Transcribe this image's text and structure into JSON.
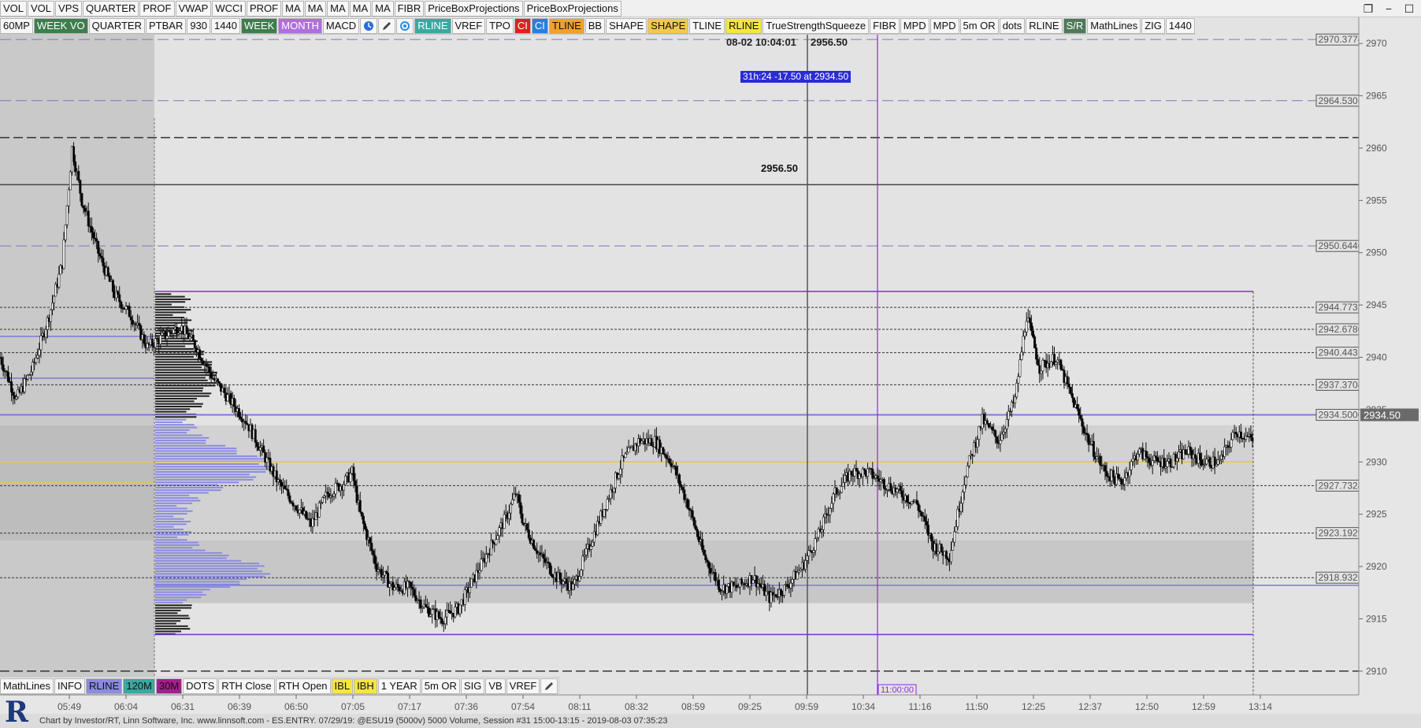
{
  "toolbar_top": [
    "VOL",
    "VOL",
    "VPS",
    "QUARTER",
    "PROF",
    "VWAP",
    "WCCI",
    "PROF",
    "MA",
    "MA",
    "MA",
    "MA",
    "MA",
    "FIBR",
    "PriceBoxProjections",
    "PriceBoxProjections"
  ],
  "toolbar_second": [
    {
      "label": "60MP",
      "bg": "#f7f7f7",
      "fg": "#111"
    },
    {
      "label": "WEEK VO",
      "bg": "#3e7d4e",
      "fg": "#ffffff"
    },
    {
      "label": "QUARTER",
      "bg": "#f7f7f7",
      "fg": "#111"
    },
    {
      "label": "PTBAR",
      "bg": "#f7f7f7",
      "fg": "#111"
    },
    {
      "label": "930",
      "bg": "#f7f7f7",
      "fg": "#111"
    },
    {
      "label": "1440",
      "bg": "#f7f7f7",
      "fg": "#111"
    },
    {
      "label": "WEEK",
      "bg": "#3e7d4e",
      "fg": "#ffffff"
    },
    {
      "label": "MONTH",
      "bg": "#b06ee0",
      "fg": "#ffffff"
    },
    {
      "label": "MACD",
      "bg": "#f7f7f7",
      "fg": "#111"
    },
    {
      "icon": "clock-icon"
    },
    {
      "icon": "pencil-icon"
    },
    {
      "icon": "refresh-icon"
    },
    {
      "label": "RLINE",
      "bg": "#3aa9a0",
      "fg": "#ffffff"
    },
    {
      "label": "VREF",
      "bg": "#f7f7f7",
      "fg": "#111"
    },
    {
      "label": "TPO",
      "bg": "#f7f7f7",
      "fg": "#111"
    },
    {
      "label": "CI",
      "bg": "#e02020",
      "fg": "#ffffff"
    },
    {
      "label": "CI",
      "bg": "#2a7ee0",
      "fg": "#ffffff"
    },
    {
      "label": "TLINE",
      "bg": "#f2a02a",
      "fg": "#111"
    },
    {
      "label": "BB",
      "bg": "#f7f7f7",
      "fg": "#111"
    },
    {
      "label": "SHAPE",
      "bg": "#f7f7f7",
      "fg": "#111"
    },
    {
      "label": "SHAPE",
      "bg": "#f2c94c",
      "fg": "#111"
    },
    {
      "label": "TLINE",
      "bg": "#f7f7f7",
      "fg": "#111"
    },
    {
      "label": "RLINE",
      "bg": "#f5e642",
      "fg": "#111"
    },
    {
      "label": "TrueStrengthSqueeze",
      "bg": "#f7f7f7",
      "fg": "#111"
    },
    {
      "label": "FIBR",
      "bg": "#f7f7f7",
      "fg": "#111"
    },
    {
      "label": "MPD",
      "bg": "#f7f7f7",
      "fg": "#111"
    },
    {
      "label": "MPD",
      "bg": "#f7f7f7",
      "fg": "#111"
    },
    {
      "label": "5m OR",
      "bg": "#f7f7f7",
      "fg": "#111"
    },
    {
      "label": "dots",
      "bg": "#f7f7f7",
      "fg": "#111"
    },
    {
      "label": "RLINE",
      "bg": "#f7f7f7",
      "fg": "#111"
    },
    {
      "label": "S/R",
      "bg": "#4f7a58",
      "fg": "#ffffff"
    },
    {
      "label": "MathLines",
      "bg": "#f7f7f7",
      "fg": "#111"
    },
    {
      "label": "ZIG",
      "bg": "#f7f7f7",
      "fg": "#111"
    },
    {
      "label": "1440",
      "bg": "#f7f7f7",
      "fg": "#111"
    }
  ],
  "toolbar_bottom": [
    {
      "label": "MathLines",
      "bg": "#f7f7f7",
      "fg": "#111"
    },
    {
      "label": "INFO",
      "bg": "#f7f7f7",
      "fg": "#111"
    },
    {
      "label": "RLINE",
      "bg": "#8b8be0",
      "fg": "#111"
    },
    {
      "label": "120M",
      "bg": "#3aa9a0",
      "fg": "#111"
    },
    {
      "label": "30M",
      "bg": "#a0208f",
      "fg": "#111"
    },
    {
      "label": "DOTS",
      "bg": "#f7f7f7",
      "fg": "#111"
    },
    {
      "label": "RTH Close",
      "bg": "#f7f7f7",
      "fg": "#111"
    },
    {
      "label": "RTH Open",
      "bg": "#f7f7f7",
      "fg": "#111"
    },
    {
      "label": "IBL",
      "bg": "#f5e642",
      "fg": "#111"
    },
    {
      "label": "IBH",
      "bg": "#f5e642",
      "fg": "#111"
    },
    {
      "label": "1 YEAR",
      "bg": "#f7f7f7",
      "fg": "#111"
    },
    {
      "label": "5m OR",
      "bg": "#f7f7f7",
      "fg": "#111"
    },
    {
      "label": "SIG",
      "bg": "#f7f7f7",
      "fg": "#111"
    },
    {
      "label": "VB",
      "bg": "#f7f7f7",
      "fg": "#111"
    },
    {
      "label": "VREF",
      "bg": "#f7f7f7",
      "fg": "#111"
    },
    {
      "icon": "pencil-icon"
    }
  ],
  "info": {
    "time": "08-02 10:04:01",
    "price": "2956.50",
    "measure": "31h:24  -17.50 at 2934.50",
    "hline_label": "2956.50",
    "time_marker": "11:00:00"
  },
  "footer": {
    "text": "Chart by Investor/RT, Linn Software, Inc. www.linnsoft.com - ES.ENTRY.  07/29/19: @ESU19 (5000v) 5000 Volume, Session #31 15:00-13:15 - 2019-08-03 07:35:23"
  },
  "chart_data": {
    "type": "candlestick",
    "symbol": "@ESU19",
    "ylim": [
      2907.5,
      2972.5
    ],
    "y_ticks": [
      2910,
      2915,
      2920,
      2925,
      2930,
      2935,
      2940,
      2945,
      2950,
      2955,
      2960,
      2965,
      2970
    ],
    "x_tick_labels": [
      "05:49",
      "06:04",
      "06:31",
      "06:39",
      "06:50",
      "07:05",
      "07:17",
      "07:36",
      "07:54",
      "08:11",
      "08:32",
      "08:59",
      "09:25",
      "09:59",
      "10:34",
      "11:16",
      "11:50",
      "12:25",
      "12:37",
      "12:50",
      "12:59",
      "13:14"
    ],
    "last_price": "2934.50",
    "price_levels": [
      {
        "value": 2970.3774,
        "label": "2970.3774",
        "style": "dashed"
      },
      {
        "value": 2964.5305,
        "label": "2964.5305",
        "style": "dashed"
      },
      {
        "value": 2950.644,
        "label": "2950.6440",
        "style": "dashed"
      },
      {
        "value": 2944.7732,
        "label": "2944.7732",
        "style": "dotted"
      },
      {
        "value": 2942.678,
        "label": "2942.6780",
        "style": "dotted"
      },
      {
        "value": 2940.4431,
        "label": "2940.4431",
        "style": "dotted"
      },
      {
        "value": 2937.3704,
        "label": "2937.3704",
        "style": "dotted"
      },
      {
        "value": 2934.5,
        "label": "2934.5000",
        "style": "solid"
      },
      {
        "value": 2927.7324,
        "label": "2927.7324",
        "style": "dotted"
      },
      {
        "value": 2923.1929,
        "label": "2923.1929",
        "style": "dotted"
      },
      {
        "value": 2918.9326,
        "label": "2918.9326",
        "style": "dotted"
      }
    ],
    "path_keypoints": [
      [
        0,
        2940
      ],
      [
        10,
        2936
      ],
      [
        20,
        2939
      ],
      [
        30,
        2944
      ],
      [
        38,
        2949
      ],
      [
        44,
        2960
      ],
      [
        50,
        2955
      ],
      [
        60,
        2950
      ],
      [
        70,
        2946
      ],
      [
        80,
        2944
      ],
      [
        90,
        2941
      ],
      [
        100,
        2942
      ],
      [
        110,
        2943
      ],
      [
        120,
        2941
      ],
      [
        130,
        2938
      ],
      [
        140,
        2936
      ],
      [
        150,
        2934
      ],
      [
        160,
        2931
      ],
      [
        170,
        2928
      ],
      [
        180,
        2926
      ],
      [
        190,
        2924
      ],
      [
        200,
        2927
      ],
      [
        210,
        2928
      ],
      [
        215,
        2929
      ],
      [
        220,
        2925
      ],
      [
        230,
        2920
      ],
      [
        240,
        2918
      ],
      [
        250,
        2918
      ],
      [
        260,
        2916
      ],
      [
        270,
        2915
      ],
      [
        280,
        2916
      ],
      [
        290,
        2919
      ],
      [
        300,
        2922
      ],
      [
        310,
        2925
      ],
      [
        315,
        2927
      ],
      [
        320,
        2924
      ],
      [
        330,
        2921
      ],
      [
        340,
        2919
      ],
      [
        350,
        2918
      ],
      [
        360,
        2922
      ],
      [
        370,
        2926
      ],
      [
        380,
        2930
      ],
      [
        390,
        2932
      ],
      [
        400,
        2932
      ],
      [
        410,
        2930
      ],
      [
        420,
        2926
      ],
      [
        430,
        2921
      ],
      [
        440,
        2918
      ],
      [
        450,
        2918
      ],
      [
        460,
        2919
      ],
      [
        470,
        2917
      ],
      [
        480,
        2918
      ],
      [
        490,
        2920
      ],
      [
        500,
        2923
      ],
      [
        510,
        2927
      ],
      [
        520,
        2929
      ],
      [
        530,
        2929
      ],
      [
        540,
        2928
      ],
      [
        550,
        2927
      ],
      [
        560,
        2926
      ],
      [
        570,
        2922
      ],
      [
        580,
        2921
      ],
      [
        590,
        2929
      ],
      [
        600,
        2934
      ],
      [
        610,
        2932
      ],
      [
        620,
        2936
      ],
      [
        627,
        2944
      ],
      [
        635,
        2939
      ],
      [
        645,
        2940
      ],
      [
        655,
        2936
      ],
      [
        665,
        2932
      ],
      [
        675,
        2929
      ],
      [
        685,
        2928
      ],
      [
        695,
        2931
      ],
      [
        705,
        2930
      ],
      [
        715,
        2930
      ],
      [
        725,
        2931
      ],
      [
        735,
        2930
      ],
      [
        745,
        2930
      ],
      [
        755,
        2933
      ],
      [
        765,
        2932
      ]
    ]
  }
}
